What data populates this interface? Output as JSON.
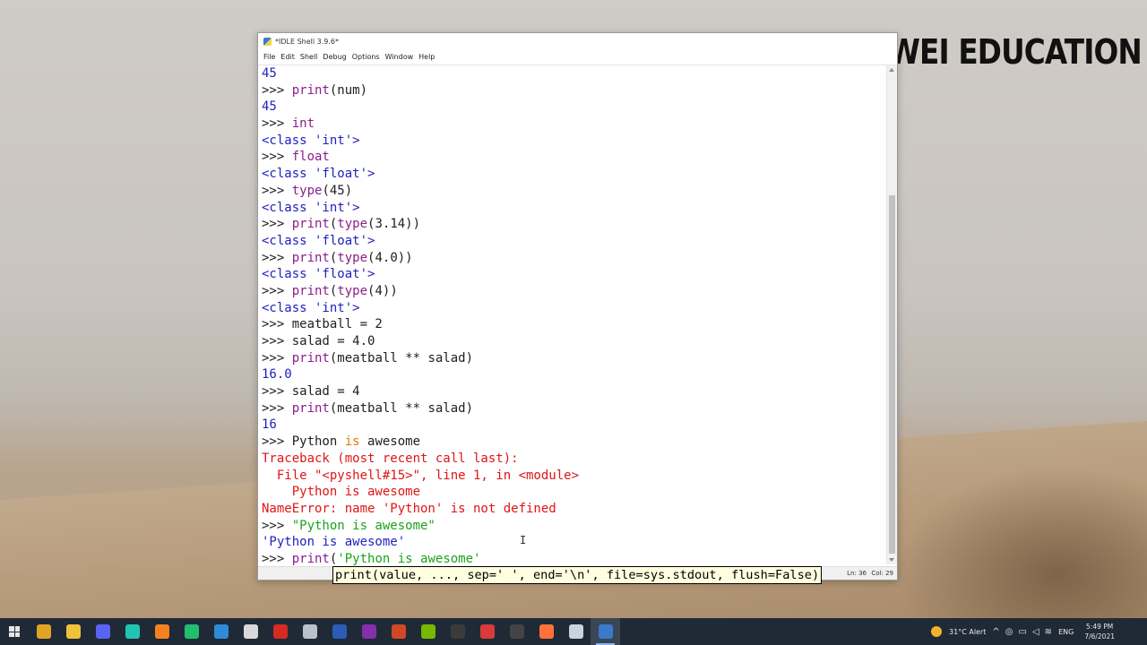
{
  "watermark": "DUOWEI EDUCATION",
  "window": {
    "title": "*IDLE Shell 3.9.6*",
    "menu": [
      "File",
      "Edit",
      "Shell",
      "Debug",
      "Options",
      "Window",
      "Help"
    ]
  },
  "lines": [
    [
      {
        "t": "45",
        "c": "blue"
      }
    ],
    [
      {
        "t": ">>> ",
        "c": "prompt"
      },
      {
        "t": "print",
        "c": "purple"
      },
      {
        "t": "(num)",
        "c": "code"
      }
    ],
    [
      {
        "t": "45",
        "c": "blue"
      }
    ],
    [
      {
        "t": ">>> ",
        "c": "prompt"
      },
      {
        "t": "int",
        "c": "purple"
      }
    ],
    [
      {
        "t": "<class 'int'>",
        "c": "blue"
      }
    ],
    [
      {
        "t": ">>> ",
        "c": "prompt"
      },
      {
        "t": "float",
        "c": "purple"
      }
    ],
    [
      {
        "t": "<class 'float'>",
        "c": "blue"
      }
    ],
    [
      {
        "t": ">>> ",
        "c": "prompt"
      },
      {
        "t": "type",
        "c": "purple"
      },
      {
        "t": "(45)",
        "c": "code"
      }
    ],
    [
      {
        "t": "<class 'int'>",
        "c": "blue"
      }
    ],
    [
      {
        "t": ">>> ",
        "c": "prompt"
      },
      {
        "t": "print",
        "c": "purple"
      },
      {
        "t": "(",
        "c": "code"
      },
      {
        "t": "type",
        "c": "purple"
      },
      {
        "t": "(3.14))",
        "c": "code"
      }
    ],
    [
      {
        "t": "<class 'float'>",
        "c": "blue"
      }
    ],
    [
      {
        "t": ">>> ",
        "c": "prompt"
      },
      {
        "t": "print",
        "c": "purple"
      },
      {
        "t": "(",
        "c": "code"
      },
      {
        "t": "type",
        "c": "purple"
      },
      {
        "t": "(4.0))",
        "c": "code"
      }
    ],
    [
      {
        "t": "<class 'float'>",
        "c": "blue"
      }
    ],
    [
      {
        "t": ">>> ",
        "c": "prompt"
      },
      {
        "t": "print",
        "c": "purple"
      },
      {
        "t": "(",
        "c": "code"
      },
      {
        "t": "type",
        "c": "purple"
      },
      {
        "t": "(4))",
        "c": "code"
      }
    ],
    [
      {
        "t": "<class 'int'>",
        "c": "blue"
      }
    ],
    [
      {
        "t": ">>> ",
        "c": "prompt"
      },
      {
        "t": "meatball = 2",
        "c": "code"
      }
    ],
    [
      {
        "t": ">>> ",
        "c": "prompt"
      },
      {
        "t": "salad = 4.0",
        "c": "code"
      }
    ],
    [
      {
        "t": ">>> ",
        "c": "prompt"
      },
      {
        "t": "print",
        "c": "purple"
      },
      {
        "t": "(meatball ** salad)",
        "c": "code"
      }
    ],
    [
      {
        "t": "16.0",
        "c": "blue"
      }
    ],
    [
      {
        "t": ">>> ",
        "c": "prompt"
      },
      {
        "t": "salad = 4",
        "c": "code"
      }
    ],
    [
      {
        "t": ">>> ",
        "c": "prompt"
      },
      {
        "t": "print",
        "c": "purple"
      },
      {
        "t": "(meatball ** salad)",
        "c": "code"
      }
    ],
    [
      {
        "t": "16",
        "c": "blue"
      }
    ],
    [
      {
        "t": ">>> ",
        "c": "prompt"
      },
      {
        "t": "Python ",
        "c": "code"
      },
      {
        "t": "is",
        "c": "orange"
      },
      {
        "t": " awesome",
        "c": "code"
      }
    ],
    [
      {
        "t": "Traceback (most recent call last):",
        "c": "red"
      }
    ],
    [
      {
        "t": "  File \"<pyshell#15>\", line 1, in <module>",
        "c": "red"
      }
    ],
    [
      {
        "t": "    Python is awesome",
        "c": "red"
      }
    ],
    [
      {
        "t": "NameError: name 'Python' is not defined",
        "c": "red"
      }
    ],
    [
      {
        "t": ">>> ",
        "c": "prompt"
      },
      {
        "t": "\"Python is awesome\"",
        "c": "green"
      }
    ],
    [
      {
        "t": "'Python is awesome'",
        "c": "blue"
      }
    ],
    [
      {
        "t": ">>> ",
        "c": "prompt"
      },
      {
        "t": "print",
        "c": "purple"
      },
      {
        "t": "(",
        "c": "code"
      },
      {
        "t": "'Python is awesome'",
        "c": "green"
      }
    ]
  ],
  "calltip": "print(value, ..., sep=' ', end='\\n', file=sys.stdout, flush=False)",
  "status": {
    "ln": "Ln: 36",
    "col": "Col: 29"
  },
  "taskbar": {
    "icons": [
      {
        "name": "chrome-icon",
        "color": "#e0a425"
      },
      {
        "name": "file-explorer-icon",
        "color": "#f0c23a"
      },
      {
        "name": "discord-icon",
        "color": "#5865f2"
      },
      {
        "name": "browser-icon",
        "color": "#21c4b3"
      },
      {
        "name": "sublime-icon",
        "color": "#f58220"
      },
      {
        "name": "pycharm-icon",
        "color": "#1fbf6e"
      },
      {
        "name": "vscode-icon",
        "color": "#2e8bd6"
      },
      {
        "name": "settings-icon",
        "color": "#d9d9d9"
      },
      {
        "name": "acrobat-icon",
        "color": "#d62b20"
      },
      {
        "name": "printer-icon",
        "color": "#b9c2cc"
      },
      {
        "name": "word-icon",
        "color": "#2b5cb8"
      },
      {
        "name": "onenote-icon",
        "color": "#8431a9"
      },
      {
        "name": "powerpoint-icon",
        "color": "#d24726"
      },
      {
        "name": "nvidia-icon",
        "color": "#76b900"
      },
      {
        "name": "terminal-icon",
        "color": "#3b3b3b"
      },
      {
        "name": "app-red-icon",
        "color": "#d93a3a"
      },
      {
        "name": "obs-icon",
        "color": "#444444"
      },
      {
        "name": "firefox-icon",
        "color": "#ff7139"
      },
      {
        "name": "notepad-icon",
        "color": "#c7d3e0"
      },
      {
        "name": "idle-icon",
        "color": "#3d79c9",
        "active": true
      }
    ],
    "tray": {
      "weather": "31°C Alert",
      "language": "ENG",
      "time": "5:49 PM",
      "date": "7/6/2021"
    }
  }
}
